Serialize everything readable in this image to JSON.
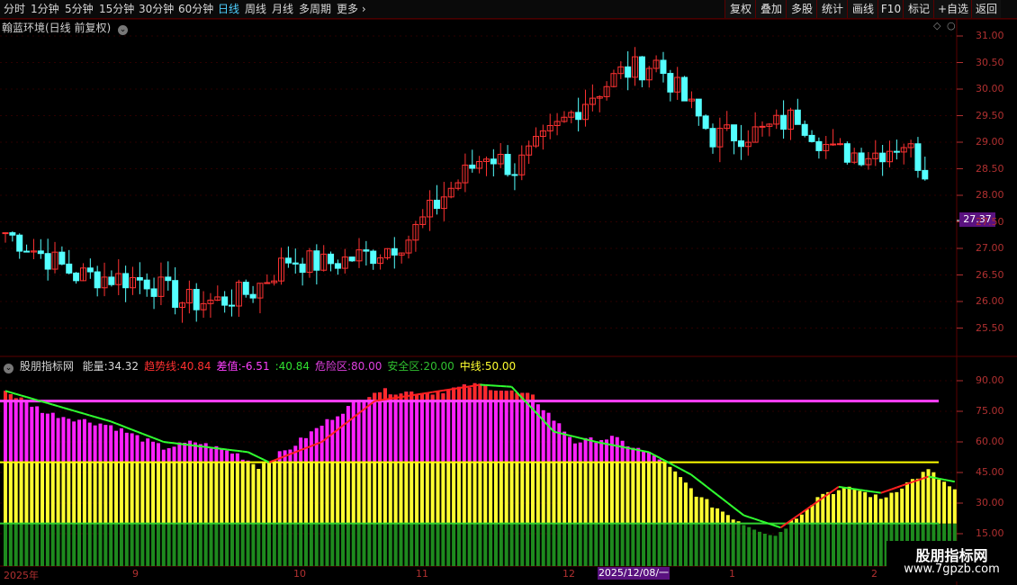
{
  "toolbar": {
    "periods": [
      "分时",
      "1分钟",
      "5分钟",
      "15分钟",
      "30分钟",
      "60分钟",
      "日线",
      "周线",
      "月线",
      "多周期",
      "更多"
    ],
    "active_period": "日线",
    "buttons": [
      "复权",
      "叠加",
      "多股",
      "统计",
      "画线",
      "F10",
      "标记",
      "+自选",
      "返回"
    ]
  },
  "main_panel": {
    "title": "翰蓝环境(日线 前复权)",
    "price_ticks": [
      "31.00",
      "30.50",
      "30.00",
      "29.50",
      "29.00",
      "28.50",
      "28.00",
      "27.50",
      "27.00",
      "26.50",
      "26.00",
      "25.50"
    ],
    "current_price": "27.37"
  },
  "indicator_panel": {
    "name": "股朋指标网",
    "items": [
      {
        "label": "能量:",
        "value": "34.32",
        "color": "#d8d8d8"
      },
      {
        "label": "趋势线:",
        "value": "40.84",
        "color": "#ff3030"
      },
      {
        "label": "差值:",
        "value": "-6.51",
        "color": "#ff40ff"
      },
      {
        "label": ":",
        "value": "40.84",
        "color": "#30e030"
      },
      {
        "label": "危险区:",
        "value": "80.00",
        "color": "#e040e0"
      },
      {
        "label": "安全区:",
        "value": "20.00",
        "color": "#30c030"
      },
      {
        "label": "中线:",
        "value": "50.00",
        "color": "#ffff30"
      }
    ],
    "ticks": [
      "90.00",
      "75.00",
      "60.00",
      "45.00",
      "30.00",
      "15.00"
    ]
  },
  "x_axis": {
    "labels": [
      "2025年",
      "9",
      "10",
      "11",
      "12",
      "1",
      "2"
    ],
    "cursor_date": "2025/12/08/一"
  },
  "watermark": {
    "title": "股朋指标网",
    "url": "www.7gpzb.com"
  },
  "colors": {
    "up": "#ff3232",
    "down": "#54ffff",
    "grid": "#5a0000",
    "axis": "#b03030",
    "danger": "#ff40ff",
    "middle": "#ffff00",
    "safe": "#30d030",
    "energy_high": "#ff20ff",
    "energy_mid": "#ffff30",
    "energy_low": "#1e8a1e",
    "trend_up": "#ff2020",
    "trend_down": "#30ff30"
  }
}
